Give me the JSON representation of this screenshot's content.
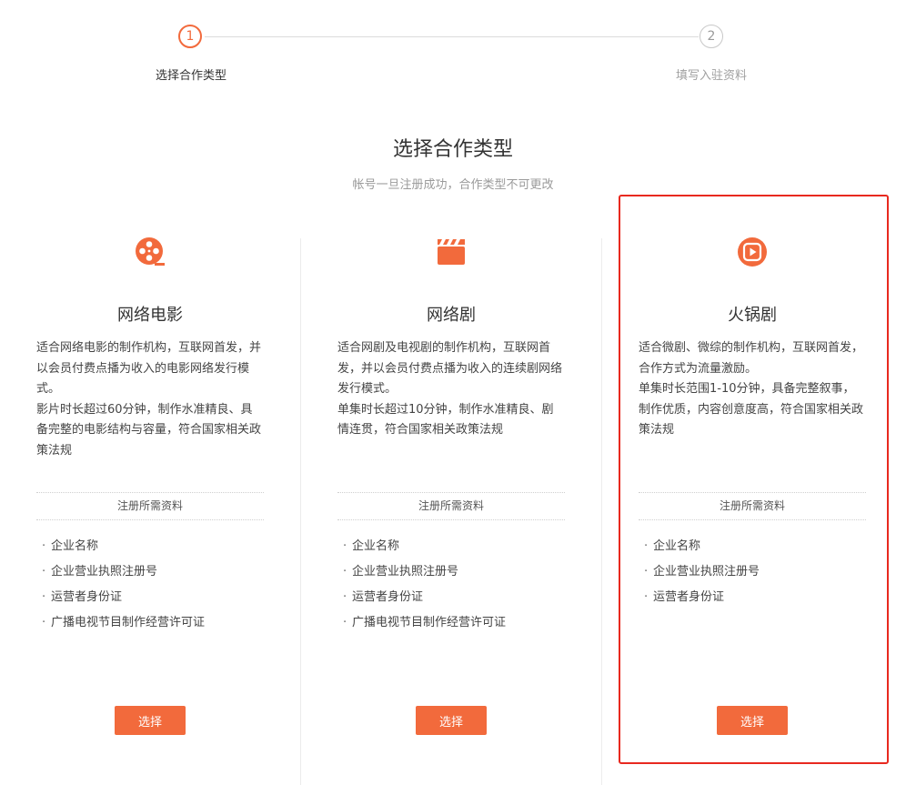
{
  "stepper": {
    "steps": [
      {
        "number": "1",
        "label": "选择合作类型"
      },
      {
        "number": "2",
        "label": "填写入驻资料"
      }
    ]
  },
  "heading": {
    "title": "选择合作类型",
    "subtitle": "帐号一旦注册成功，合作类型不可更改"
  },
  "cards": [
    {
      "icon": "film-reel-icon",
      "title": "网络电影",
      "desc": [
        "适合网络电影的制作机构，互联网首发，并以会员付费点播为收入的电影网络发行模式。",
        "影片时长超过60分钟，制作水准精良、具备完整的电影结构与容量，符合国家相关政策法规"
      ],
      "req_header": "注册所需资料",
      "requirements": [
        "企业名称",
        "企业营业执照注册号",
        "运营者身份证",
        "广播电视节目制作经营许可证"
      ],
      "button_label": "选择"
    },
    {
      "icon": "clapperboard-icon",
      "title": "网络剧",
      "desc": [
        "适合网剧及电视剧的制作机构，互联网首发，并以会员付费点播为收入的连续剧网络发行模式。",
        "单集时长超过10分钟，制作水准精良、剧情连贯，符合国家相关政策法规"
      ],
      "req_header": "注册所需资料",
      "requirements": [
        "企业名称",
        "企业营业执照注册号",
        "运营者身份证",
        "广播电视节目制作经营许可证"
      ],
      "button_label": "选择"
    },
    {
      "icon": "play-video-icon",
      "title": "火锅剧",
      "desc": [
        "适合微剧、微综的制作机构，互联网首发，合作方式为流量激励。",
        "单集时长范围1-10分钟，具备完整叙事，制作优质，内容创意度高，符合国家相关政策法规"
      ],
      "req_header": "注册所需资料",
      "requirements": [
        "企业名称",
        "企业营业执照注册号",
        "运营者身份证"
      ],
      "button_label": "选择"
    }
  ],
  "colors": {
    "accent": "#f26a3c",
    "highlight": "#e8291f",
    "divider": "#ececec",
    "muted_text": "#9a9a9a"
  }
}
